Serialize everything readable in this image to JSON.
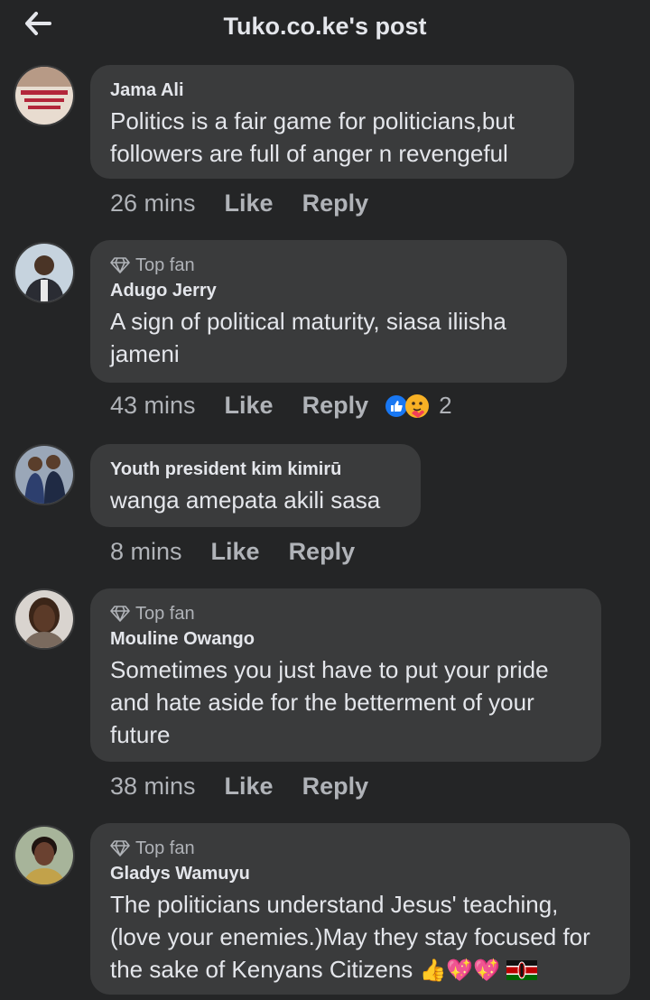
{
  "header": {
    "title": "Tuko.co.ke's post"
  },
  "comments": [
    {
      "author": "Jama Ali",
      "badge": "",
      "text": "Politics is a fair game for politicians,but followers are full of anger n revengeful",
      "time": "26 mins",
      "like": "Like",
      "reply": "Reply"
    },
    {
      "author": "Adugo Jerry",
      "badge": "Top fan",
      "text": "A sign of political maturity, siasa iliisha jameni",
      "time": "43 mins",
      "like": "Like",
      "reply": "Reply",
      "reaction_count": "2"
    },
    {
      "author": "Youth president kim kimirū",
      "badge": "",
      "text": "wanga amepata akili sasa",
      "time": "8 mins",
      "like": "Like",
      "reply": "Reply"
    },
    {
      "author": "Mouline Owango",
      "badge": "Top fan",
      "text": "Sometimes you just have to put your pride and hate aside for the betterment of your future",
      "time": "38 mins",
      "like": "Like",
      "reply": "Reply"
    },
    {
      "author": "Gladys Wamuyu",
      "badge": "Top fan",
      "text": "The politicians understand Jesus' teaching, (love your enemies.)May they stay focused for the sake of Kenyans Citizens",
      "emoji_tail": "👍💖💖",
      "time": "",
      "like": "",
      "reply": ""
    }
  ],
  "icons": {
    "back": "arrow-left-icon",
    "badge": "diamond-icon",
    "like_reaction": "like-reaction-icon",
    "care_reaction": "care-reaction-icon",
    "flag": "kenya-flag-icon"
  },
  "colors": {
    "background": "#242526",
    "bubble": "#3a3b3c",
    "text": "#e4e6eb",
    "muted": "#b0b3b8",
    "like_blue": "#1877f2"
  }
}
